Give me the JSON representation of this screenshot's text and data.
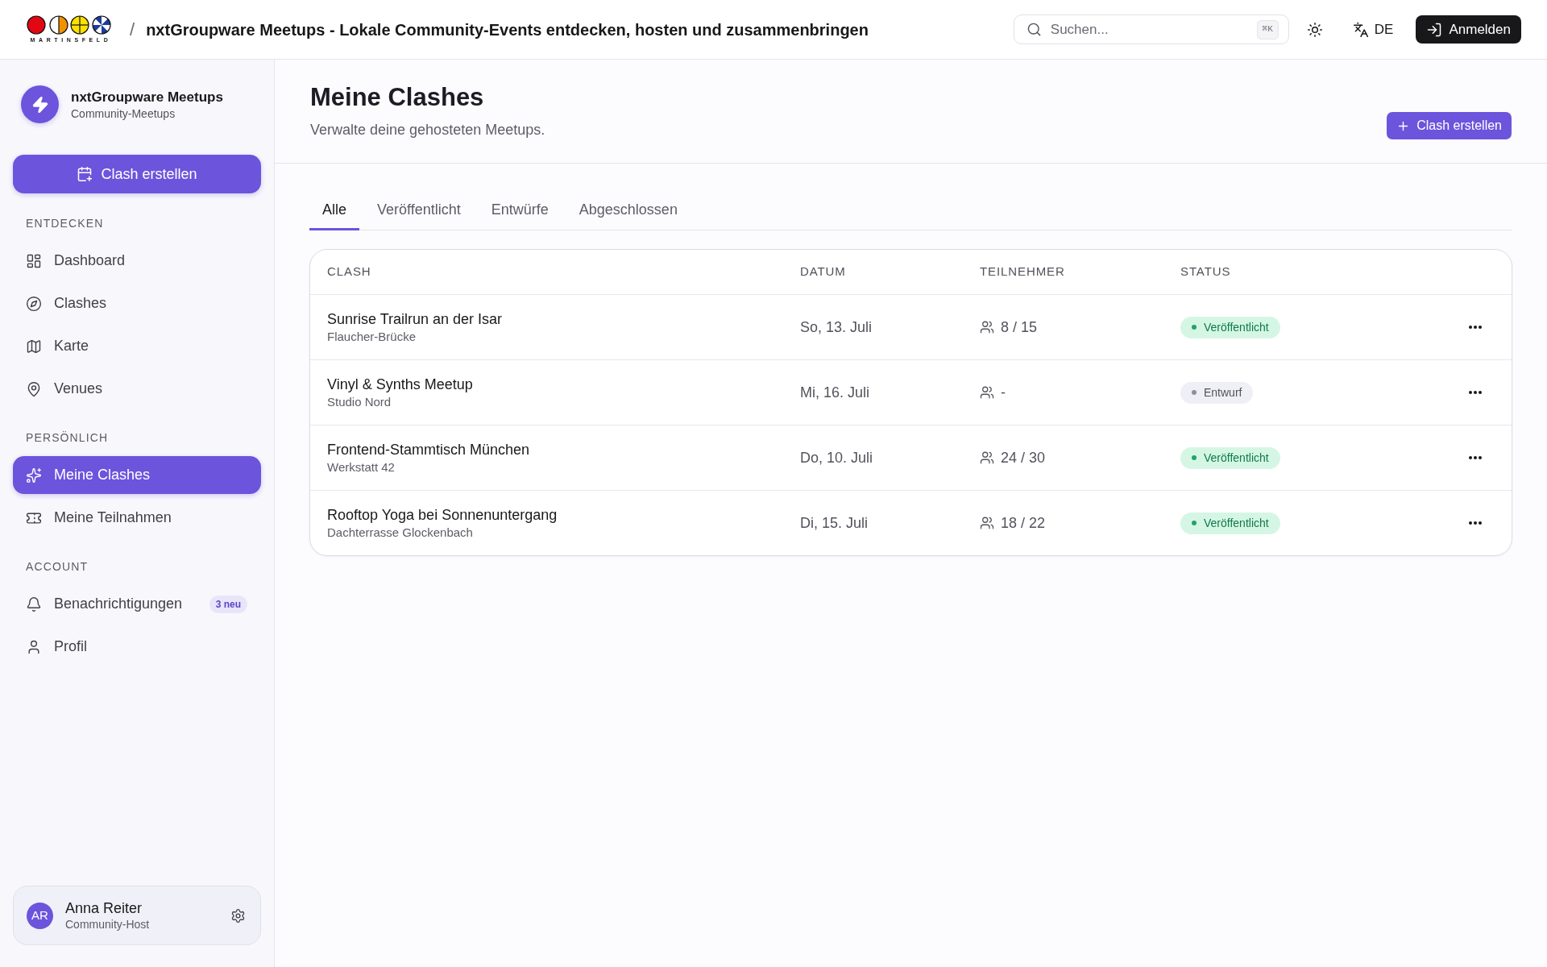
{
  "topbar": {
    "logo_text": "MARTINSFELD",
    "separator": "/",
    "title": "nxtGroupware Meetups - Lokale Community-Events entdecken, hosten und zusammenbringen",
    "search": {
      "placeholder": "Suchen...",
      "shortcut": "⌘K"
    },
    "language": "DE",
    "login_button": "Anmelden"
  },
  "sidebar": {
    "brand": {
      "name": "nxtGroupware Meetups",
      "subtitle": "Community-Meetups"
    },
    "create_button": "Clash erstellen",
    "sections": [
      {
        "title": "ENTDECKEN",
        "items": [
          {
            "label": "Dashboard",
            "selected": false
          },
          {
            "label": "Clashes",
            "selected": false
          },
          {
            "label": "Karte",
            "selected": false
          },
          {
            "label": "Venues",
            "selected": false
          }
        ]
      },
      {
        "title": "PERSÖNLICH",
        "items": [
          {
            "label": "Meine Clashes",
            "selected": true
          },
          {
            "label": "Meine Teilnahmen",
            "selected": false
          }
        ]
      },
      {
        "title": "ACCOUNT",
        "items": [
          {
            "label": "Benachrichtigungen",
            "selected": false,
            "badge": "3 neu"
          },
          {
            "label": "Profil",
            "selected": false
          }
        ]
      }
    ],
    "user": {
      "initials": "AR",
      "name": "Anna Reiter",
      "role": "Community-Host"
    }
  },
  "page": {
    "title": "Meine Clashes",
    "subtitle": "Verwalte deine gehosteten Meetups.",
    "create_button": "Clash erstellen",
    "tabs": [
      {
        "label": "Alle",
        "selected": true
      },
      {
        "label": "Veröffentlicht",
        "selected": false
      },
      {
        "label": "Entwürfe",
        "selected": false
      },
      {
        "label": "Abgeschlossen",
        "selected": false
      }
    ],
    "table": {
      "columns": [
        "CLASH",
        "DATUM",
        "TEILNEHMER",
        "STATUS"
      ],
      "rows": [
        {
          "title": "Sunrise Trailrun an der Isar",
          "venue": "Flaucher-Brücke",
          "date": "So, 13. Juli",
          "participants": "8 / 15",
          "status": {
            "label": "Veröffentlicht",
            "kind": "published",
            "color": "#22a365"
          }
        },
        {
          "title": "Vinyl & Synths Meetup",
          "venue": "Studio Nord",
          "date": "Mi, 16. Juli",
          "participants": "-",
          "status": {
            "label": "Entwurf",
            "kind": "draft",
            "color": "#8e8ea0"
          }
        },
        {
          "title": "Frontend-Stammtisch München",
          "venue": "Werkstatt 42",
          "date": "Do, 10. Juli",
          "participants": "24 / 30",
          "status": {
            "label": "Veröffentlicht",
            "kind": "published",
            "color": "#22a365"
          }
        },
        {
          "title": "Rooftop Yoga bei Sonnenuntergang",
          "venue": "Dachterrasse Glockenbach",
          "date": "Di, 15. Juli",
          "participants": "18 / 22",
          "status": {
            "label": "Veröffentlicht",
            "kind": "published",
            "color": "#22a365"
          }
        }
      ]
    }
  }
}
